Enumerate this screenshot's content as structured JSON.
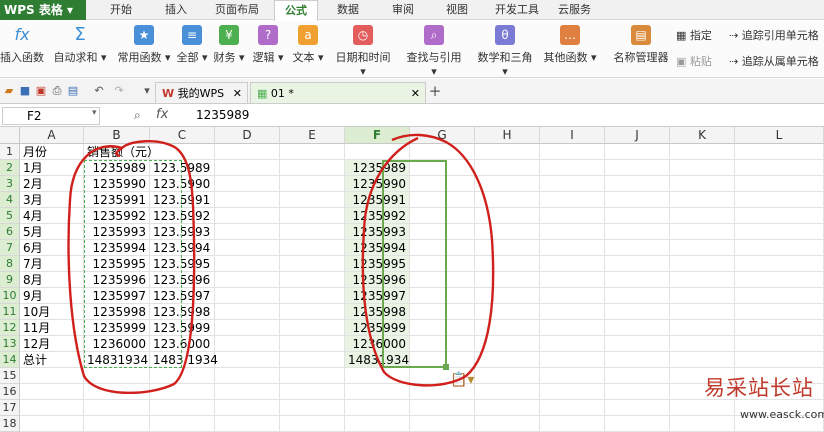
{
  "app": {
    "title": "WPS 表格"
  },
  "menu": [
    "开始",
    "插入",
    "页面布局",
    "公式",
    "数据",
    "审阅",
    "视图",
    "开发工具",
    "云服务"
  ],
  "ribbon": {
    "buttons": [
      {
        "label": "插入函数",
        "icon": "fx-icon",
        "glyph": "fx",
        "color": "#3b8fd4"
      },
      {
        "label": "自动求和",
        "icon": "sum-icon",
        "glyph": "Σ",
        "color": "#3b8fd4"
      },
      {
        "label": "常用函数",
        "icon": "star-icon",
        "glyph": "★",
        "color": "#4a90d9"
      },
      {
        "label": "全部",
        "icon": "list-icon",
        "glyph": "≡",
        "color": "#4a90d9"
      },
      {
        "label": "财务",
        "icon": "finance-icon",
        "glyph": "¥",
        "color": "#4caf50"
      },
      {
        "label": "逻辑",
        "icon": "logic-icon",
        "glyph": "?",
        "color": "#b06cc9"
      },
      {
        "label": "文本",
        "icon": "text-icon",
        "glyph": "a",
        "color": "#f0a030"
      },
      {
        "label": "日期和时间",
        "icon": "clock-icon",
        "glyph": "◷",
        "color": "#e35d5d"
      },
      {
        "label": "查找与引用",
        "icon": "search-icon",
        "glyph": "⌕",
        "color": "#b06cc9"
      },
      {
        "label": "数学和三角",
        "icon": "theta-icon",
        "glyph": "θ",
        "color": "#7b7bd6"
      },
      {
        "label": "其他函数",
        "icon": "more-icon",
        "glyph": "…",
        "color": "#e08040"
      },
      {
        "label": "名称管理器",
        "icon": "name-manager-icon",
        "glyph": "▤",
        "color": "#d98a3a"
      }
    ],
    "side": {
      "specify": "指定",
      "paste": "粘贴",
      "trace_precedents": "追踪引用单元格",
      "trace_dependents": "追踪从属单元格"
    }
  },
  "tabs": [
    {
      "label": "我的WPS"
    },
    {
      "label": "01 *"
    }
  ],
  "formula": {
    "cell_ref": "F2",
    "fx": "fx",
    "content": "1235989"
  },
  "columns": [
    "A",
    "B",
    "C",
    "D",
    "E",
    "F",
    "G",
    "H",
    "I",
    "J",
    "K",
    "L"
  ],
  "rows": [
    "1",
    "2",
    "3",
    "4",
    "5",
    "6",
    "7",
    "8",
    "9",
    "10",
    "11",
    "12",
    "13",
    "14",
    "15",
    "16",
    "17",
    "18"
  ],
  "sheet": {
    "headers": {
      "a": "月份",
      "b": "销售额（元）"
    },
    "data": [
      {
        "a": "1月",
        "b": "1235989",
        "c": "123.5989",
        "f": "1235989"
      },
      {
        "a": "2月",
        "b": "1235990",
        "c": "123.5990",
        "f": "1235990"
      },
      {
        "a": "3月",
        "b": "1235991",
        "c": "123.5991",
        "f": "1235991"
      },
      {
        "a": "4月",
        "b": "1235992",
        "c": "123.5992",
        "f": "1235992"
      },
      {
        "a": "5月",
        "b": "1235993",
        "c": "123.5993",
        "f": "1235993"
      },
      {
        "a": "6月",
        "b": "1235994",
        "c": "123.5994",
        "f": "1235994"
      },
      {
        "a": "7月",
        "b": "1235995",
        "c": "123.5995",
        "f": "1235995"
      },
      {
        "a": "8月",
        "b": "1235996",
        "c": "123.5996",
        "f": "1235996"
      },
      {
        "a": "9月",
        "b": "1235997",
        "c": "123.5997",
        "f": "1235997"
      },
      {
        "a": "10月",
        "b": "1235998",
        "c": "123.5998",
        "f": "1235998"
      },
      {
        "a": "11月",
        "b": "1235999",
        "c": "123.5999",
        "f": "1235999"
      },
      {
        "a": "12月",
        "b": "1236000",
        "c": "123.6000",
        "f": "1236000"
      },
      {
        "a": "总计",
        "b": "14831934",
        "c": "1483.1934",
        "f": "14831934"
      }
    ]
  },
  "watermark": {
    "text": "易采站长站",
    "url": "www.easck.com"
  },
  "colors": {
    "brand": "#2e7d32",
    "annotation": "#d0201c",
    "selection": "#6aa84f"
  }
}
